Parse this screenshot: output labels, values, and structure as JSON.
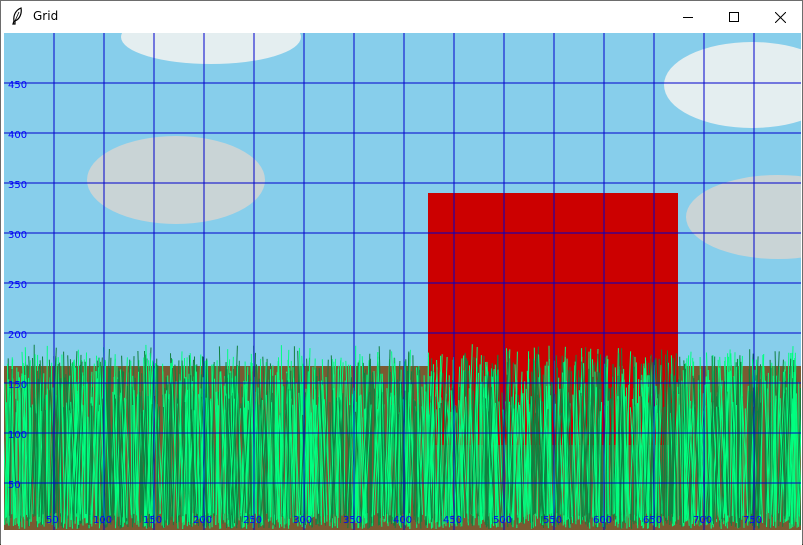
{
  "window": {
    "title": "Grid"
  },
  "icons": {
    "app": "feather-icon",
    "minimize": "minimize-icon",
    "maximize": "maximize-icon",
    "close": "close-icon"
  },
  "scene": {
    "colors": {
      "sky": "#87ceeb",
      "cloud": "#e4eef0",
      "cloud_shaded": "#c9d4d6",
      "building": "#cc0000",
      "ground": "#7a5a32",
      "grass_light": "#00ff80",
      "grass_dark": "#108040",
      "grid": "#0000cc",
      "label": "#0000ff"
    }
  },
  "grid": {
    "y_labels": [
      "450",
      "400",
      "350",
      "300",
      "250",
      "200",
      "150",
      "100",
      "50"
    ],
    "x_labels": [
      "50",
      "100",
      "150",
      "200",
      "250",
      "300",
      "350",
      "400",
      "450",
      "500",
      "550",
      "600",
      "650",
      "700",
      "750"
    ]
  }
}
